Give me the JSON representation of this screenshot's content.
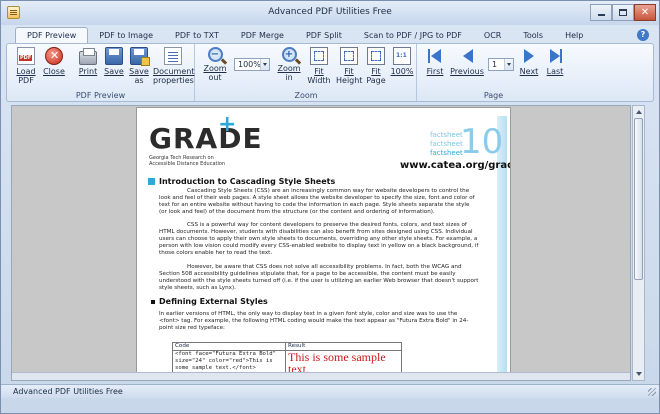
{
  "window": {
    "title": "Advanced PDF Utilities Free"
  },
  "tabs": [
    {
      "label": "PDF Preview"
    },
    {
      "label": "PDF to Image"
    },
    {
      "label": "PDF to TXT"
    },
    {
      "label": "PDF Merge"
    },
    {
      "label": "PDF Split"
    },
    {
      "label": "Scan to PDF / JPG to PDF"
    },
    {
      "label": "OCR"
    },
    {
      "label": "Tools"
    },
    {
      "label": "Help"
    }
  ],
  "ribbon": {
    "preview_group": {
      "label": "PDF Preview",
      "load": [
        "Load",
        "PDF"
      ],
      "close": "Close",
      "print": "Print",
      "save": "Save",
      "saveas": [
        "Save",
        "as"
      ],
      "props": [
        "Document",
        "properties"
      ]
    },
    "zoom_group": {
      "label": "Zoom",
      "zoom_out": [
        "Zoom",
        "out"
      ],
      "zoom_value": "100%",
      "zoom_in": [
        "Zoom",
        "in"
      ],
      "fit_width": [
        "Fit",
        "Width"
      ],
      "fit_height": [
        "Fit",
        "Height"
      ],
      "fit_page": [
        "Fit",
        "Page"
      ],
      "actual": "100%"
    },
    "page_group": {
      "label": "Page",
      "first": "First",
      "previous": "Previous",
      "page_value": "1",
      "next": "Next",
      "last": "Last"
    }
  },
  "document": {
    "logo": "GRADE",
    "logo_sub": [
      "Georgia Tech Research on",
      "Accessible Distance Education"
    ],
    "factsheets": [
      "factsheet",
      "factsheet",
      "factsheet"
    ],
    "number": "10",
    "url": "www.catea.org/grade",
    "section1_title": "Introduction to Cascading Style Sheets",
    "p1": "Cascading Style Sheets (CSS) are an increasingly common way for website developers to control the look and feel of their web pages. A style sheet allows the website developer to specify the size, font and color of text for an entire website without having to code the information in each page. Style sheets separate the style (or look and feel) of the document from the structure (or the content and ordering of information).",
    "p2": "CSS is a powerful way for content developers to preserve the desired fonts, colors, and text sizes of HTML documents. However, students with disabilities can also benefit from sites designed using CSS. Individual users can choose to apply their own style sheets to documents, overriding any other style sheets. For example, a person with low vision could modify every CSS-enabled website to display text in yellow on a black background, if those colors enable her to read the text.",
    "p3": "However, be aware that CSS does not solve all accessibility problems. In fact, both the WCAG and Section 508 accessibility guidelines stipulate that, for a page to be accessible, the content must be easily understood with the style sheets turned off (i.e. if the user is utilizing an earlier Web browser that doesn't support style sheets, such as Lynx).",
    "section2_title": "Defining External Styles",
    "p4": "In earlier versions of HTML, the only way to display text in a given font style, color and size was to use the <font> tag. For example, the following HTML coding would make the text appear as \"Futura Extra Bold\" in 24-point size red typeface:",
    "table": {
      "code_header": "Code",
      "result_header": "Result",
      "code": "<font face=\"Futura Extra Bold\" size=\"24\" color=\"red\">This is some sample text.</font>",
      "result": "This is some sample text."
    }
  },
  "status": {
    "text": "Advanced PDF Utilities Free"
  },
  "colors": {
    "accent": "#2fa8d8",
    "result_red": "#cc1a1a",
    "nav_blue": "#3a75c9"
  }
}
